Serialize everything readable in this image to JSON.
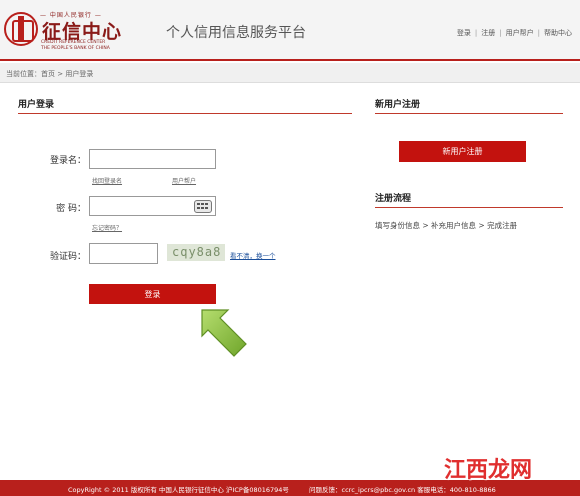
{
  "header": {
    "logo_top": "— 中国人民银行 —",
    "logo_main": "征信中心",
    "logo_en1": "CREDIT REFERENCE CENTER",
    "logo_en2": "THE PEOPLE'S BANK OF CHINA",
    "platform_title": "个人信用信息服务平台",
    "nav": [
      "登录",
      "注册",
      "用户帮户",
      "帮助中心"
    ]
  },
  "breadcrumb": "当前位置：首页 > 用户登录",
  "login": {
    "section_title": "用户登录",
    "username_label": "登录名：",
    "username_value": "",
    "forgot_username": "找回登录名",
    "user_help": "用户帮户",
    "password_label": "密  码：",
    "password_value": "",
    "forgot_password": "忘记密码？",
    "captcha_label": "验证码：",
    "captcha_value": "",
    "captcha_text": "cqy8a8",
    "captcha_refresh": "看不清，换一个",
    "login_button": "登录"
  },
  "register": {
    "section_title": "新用户注册",
    "button": "新用户注册",
    "flow_title": "注册流程",
    "flow_steps": "填写身份信息 > 补充用户信息 > 完成注册"
  },
  "footer": {
    "copyright": "CopyRight © 2011    版权所有    中国人民银行征信中心    沪ICP备08016794号",
    "feedback": "问题反馈：ccrc_ipcrs@pbc.gov.cn    客服电话：400-810-8866"
  },
  "watermark": "江西龙网",
  "colors": {
    "brand_red": "#b8201c",
    "button_red": "#c3120e",
    "arrow_green": "#8dc63f"
  },
  "icons": [
    "keyboard-icon",
    "arrow-pointer-icon",
    "logo-seal-icon"
  ]
}
